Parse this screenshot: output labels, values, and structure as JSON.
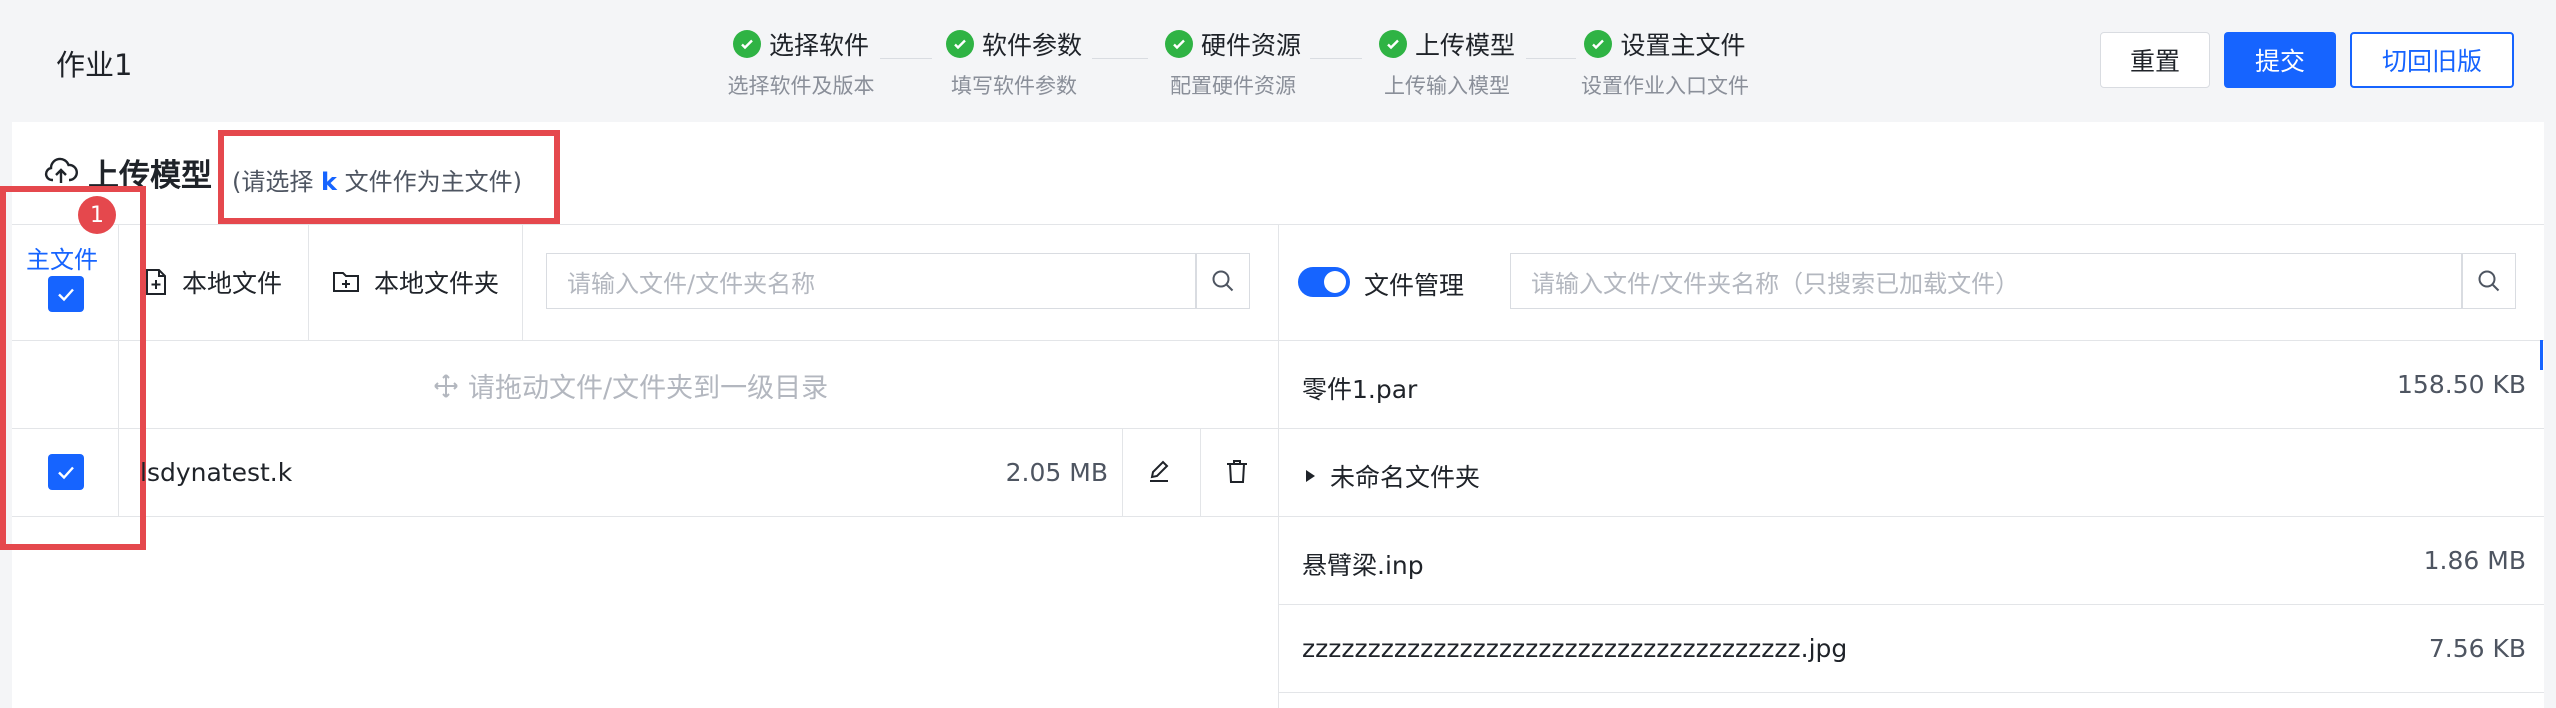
{
  "header": {
    "job_title": "作业1",
    "steps": [
      {
        "title": "选择软件",
        "sub": "选择软件及版本"
      },
      {
        "title": "软件参数",
        "sub": "填写软件参数"
      },
      {
        "title": "硬件资源",
        "sub": "配置硬件资源"
      },
      {
        "title": "上传模型",
        "sub": "上传输入模型"
      },
      {
        "title": "设置主文件",
        "sub": "设置作业入口文件"
      }
    ],
    "buttons": {
      "reset": "重置",
      "submit": "提交",
      "switch_old": "切回旧版"
    }
  },
  "upload": {
    "title": "上传模型",
    "hint_prefix": "(请选择",
    "hint_ext": "k",
    "hint_suffix": "文件作为主文件)",
    "badge": "1",
    "mainfile_label": "主文件",
    "local_file": "本地文件",
    "local_folder": "本地文件夹",
    "search_placeholder": "请输入文件/文件夹名称",
    "drop_hint": "请拖动文件/文件夹到一级目录",
    "files": [
      {
        "name": "lsdynatest.k",
        "size": "2.05 MB",
        "checked": true
      }
    ]
  },
  "manager": {
    "toggle_label": "文件管理",
    "search_placeholder": "请输入文件/文件夹名称（只搜索已加载文件）",
    "items": [
      {
        "name": "零件1.par",
        "size": "158.50 KB"
      },
      {
        "name": "未命名文件夹",
        "size": ""
      },
      {
        "name": "悬臂梁.inp",
        "size": "1.86 MB"
      },
      {
        "name": "zzzzzzzzzzzzzzzzzzzzzzzzzzzzzzzzzzzzzz.jpg",
        "size": "7.56 KB"
      }
    ]
  },
  "colors": {
    "primary": "#1664ff",
    "success": "#2fb344",
    "annotation": "#e5484d"
  }
}
